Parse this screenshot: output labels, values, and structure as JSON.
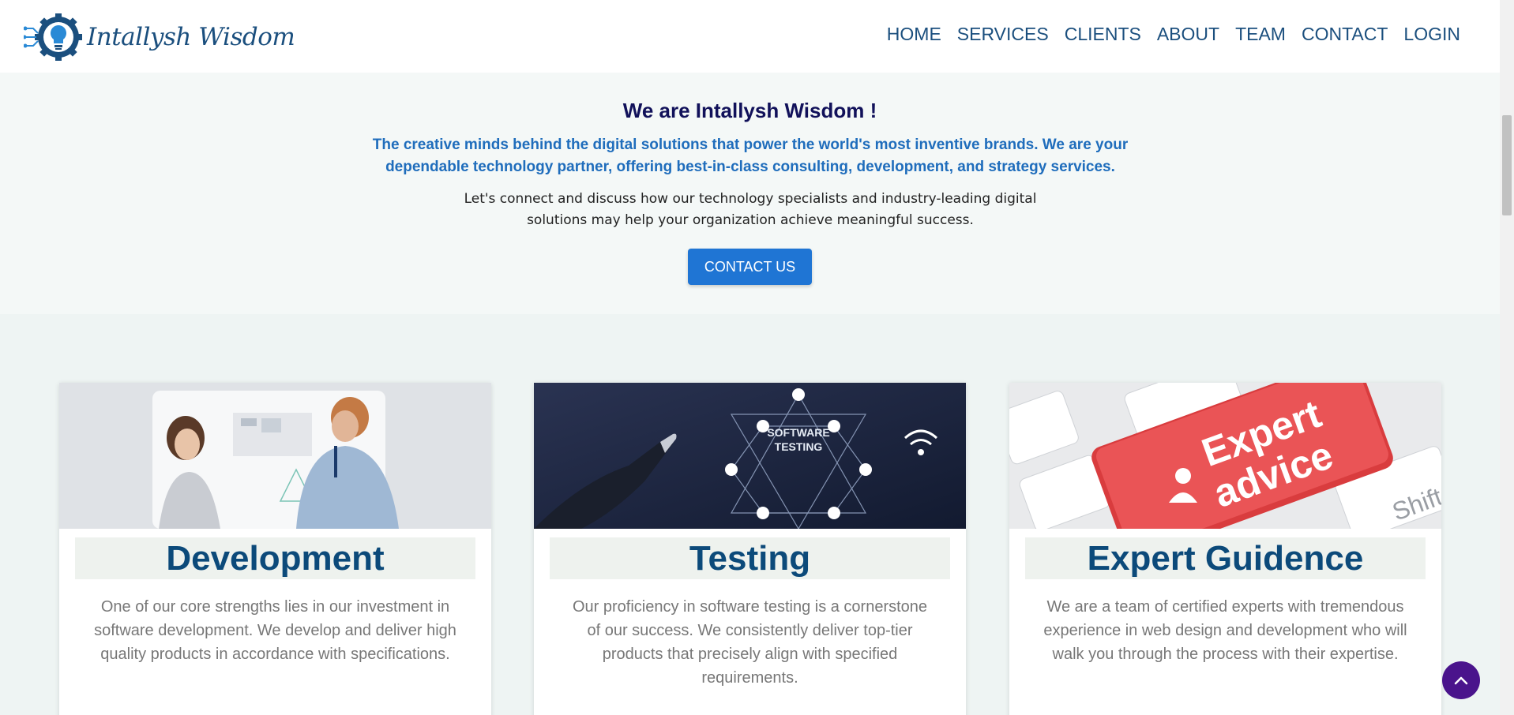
{
  "brand": {
    "name": "Intallysh Wisdom"
  },
  "nav": {
    "items": [
      "HOME",
      "SERVICES",
      "CLIENTS",
      "ABOUT",
      "TEAM",
      "CONTACT",
      "LOGIN"
    ]
  },
  "hero": {
    "title": "We are Intallysh Wisdom !",
    "subtitle": "The creative minds behind the digital solutions that power the world's most inventive brands. We are your dependable technology partner, offering best-in-class consulting, development, and strategy services.",
    "body": "Let's connect and discuss how our technology specialists and industry-leading digital solutions may help your organization achieve meaningful success.",
    "button": "CONTACT US"
  },
  "cards": [
    {
      "title": "Development",
      "text": "One of our core strengths lies in our investment in software development. We develop and deliver high quality products in accordance with specifications."
    },
    {
      "title": "Testing",
      "text": "Our proficiency in software testing is a cornerstone of our success. We consistently deliver top-tier products that precisely align with specified requirements."
    },
    {
      "title": "Expert Guidence",
      "text": "We are a team of certified experts with tremendous experience in web design and development who will walk you through the process with their expertise."
    }
  ],
  "images": {
    "testing_label_1": "SOFTWARE",
    "testing_label_2": "TESTING",
    "key_line_1": "Expert",
    "key_line_2": "advice",
    "key_shift": "Shift"
  },
  "colors": {
    "brand": "#1b4f7e",
    "primary_button": "#1f75d4",
    "back_to_top": "#4a148c",
    "hero_title": "#11115a",
    "hero_subtitle": "#1f6dbc"
  },
  "icons": {
    "logo": "gear-bulb-icon",
    "back_to_top": "chevron-up-icon"
  }
}
